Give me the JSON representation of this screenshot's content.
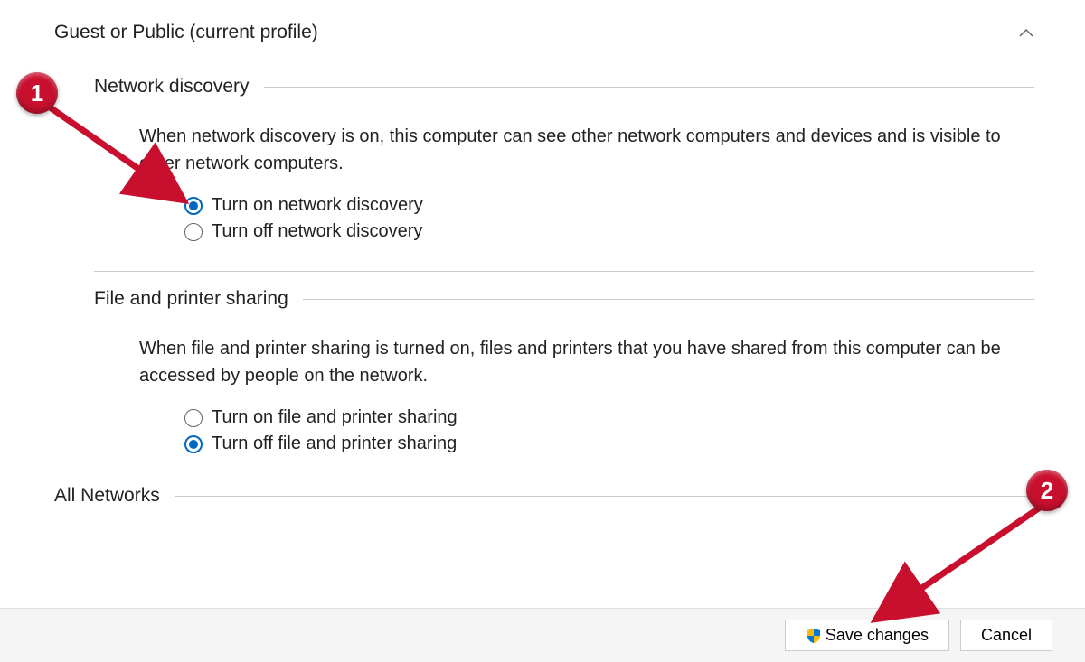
{
  "profile": {
    "title": "Guest or Public (current profile)"
  },
  "networkDiscovery": {
    "title": "Network discovery",
    "description": "When network discovery is on, this computer can see other network computers and devices and is visible to other network computers.",
    "onLabel": "Turn on network discovery",
    "offLabel": "Turn off network discovery"
  },
  "filePrinter": {
    "title": "File and printer sharing",
    "description": "When file and printer sharing is turned on, files and printers that you have shared from this computer can be accessed by people on the network.",
    "onLabel": "Turn on file and printer sharing",
    "offLabel": "Turn off file and printer sharing"
  },
  "allNetworks": {
    "title": "All Networks"
  },
  "buttons": {
    "save": "Save changes",
    "cancel": "Cancel"
  },
  "annotations": {
    "one": "1",
    "two": "2"
  }
}
